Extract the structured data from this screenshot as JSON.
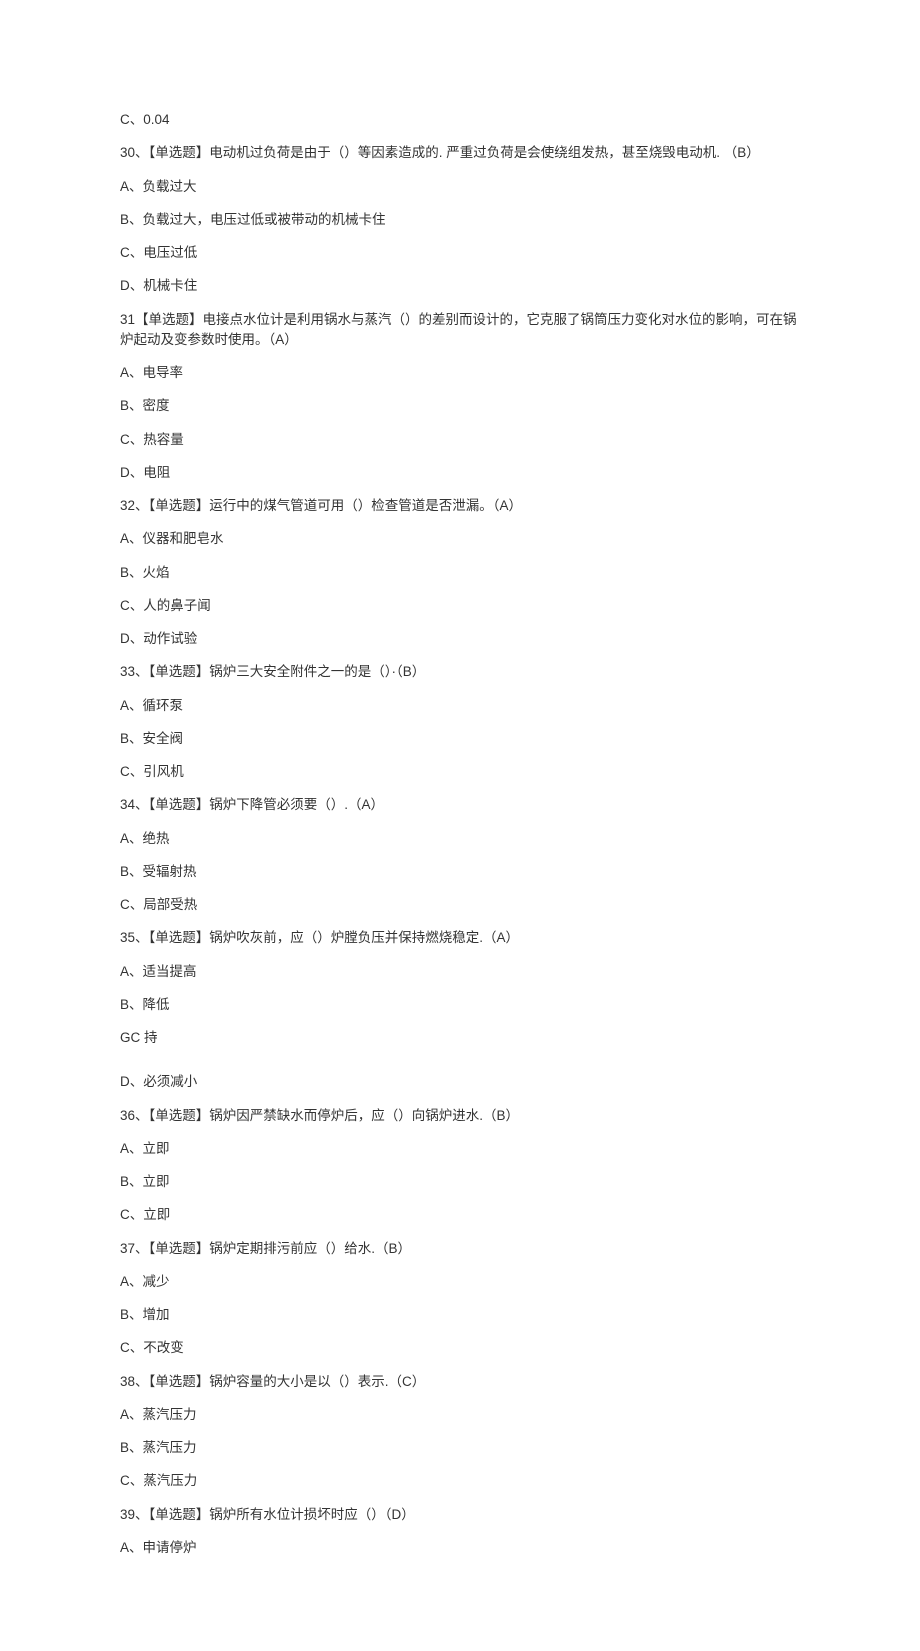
{
  "lines": [
    "C、0.04",
    "30、【单选题】电动机过负荷是由于（）等因素造成的. 严重过负荷是会使绕组发热，甚至烧毁电动机. （B）",
    "A、负载过大",
    "B、负载过大，电压过低或被带动的机械卡住",
    "C、电压过低",
    "D、机械卡住",
    "31【单选题】电接点水位计是利用锅水与蒸汽（）的差别而设计的，它克服了锅筒压力变化对水位的影响，可在锅炉起动及变参数时使用。（A）",
    "A、电导率",
    "B、密度",
    "C、热容量",
    "D、电阻",
    "32、【单选题】运行中的煤气管道可用（）检查管道是否泄漏。（A）",
    "A、仪器和肥皂水",
    "B、火焰",
    "C、人的鼻子闻",
    "D、动作试验",
    "33、【单选题】锅炉三大安全附件之一的是（）·（B）",
    "A、循环泵",
    "B、安全阀",
    "C、引风机",
    "34、【单选题】锅炉下降管必须要（）.（A）",
    "A、绝热",
    "B、受辐射热",
    "C、局部受热",
    "35、【单选题】锅炉吹灰前，应（）炉膛负压并保持燃烧稳定.（A）",
    "A、适当提高",
    "B、降低",
    "GC 持",
    "D、必须减小",
    "36、【单选题】锅炉因严禁缺水而停炉后，应（）向锅炉进水.（B）",
    "A、立即",
    "B、立即",
    "C、立即",
    "37、【单选题】锅炉定期排污前应（）给水.（B）",
    "A、减少",
    "B、增加",
    "C、不改变",
    "38、【单选题】锅炉容量的大小是以（）表示.（C）",
    "A、蒸汽压力",
    "B、蒸汽压力",
    "C、蒸汽压力",
    "39、【单选题】锅炉所有水位计损坏时应（）（D）",
    "A、申请停炉"
  ]
}
